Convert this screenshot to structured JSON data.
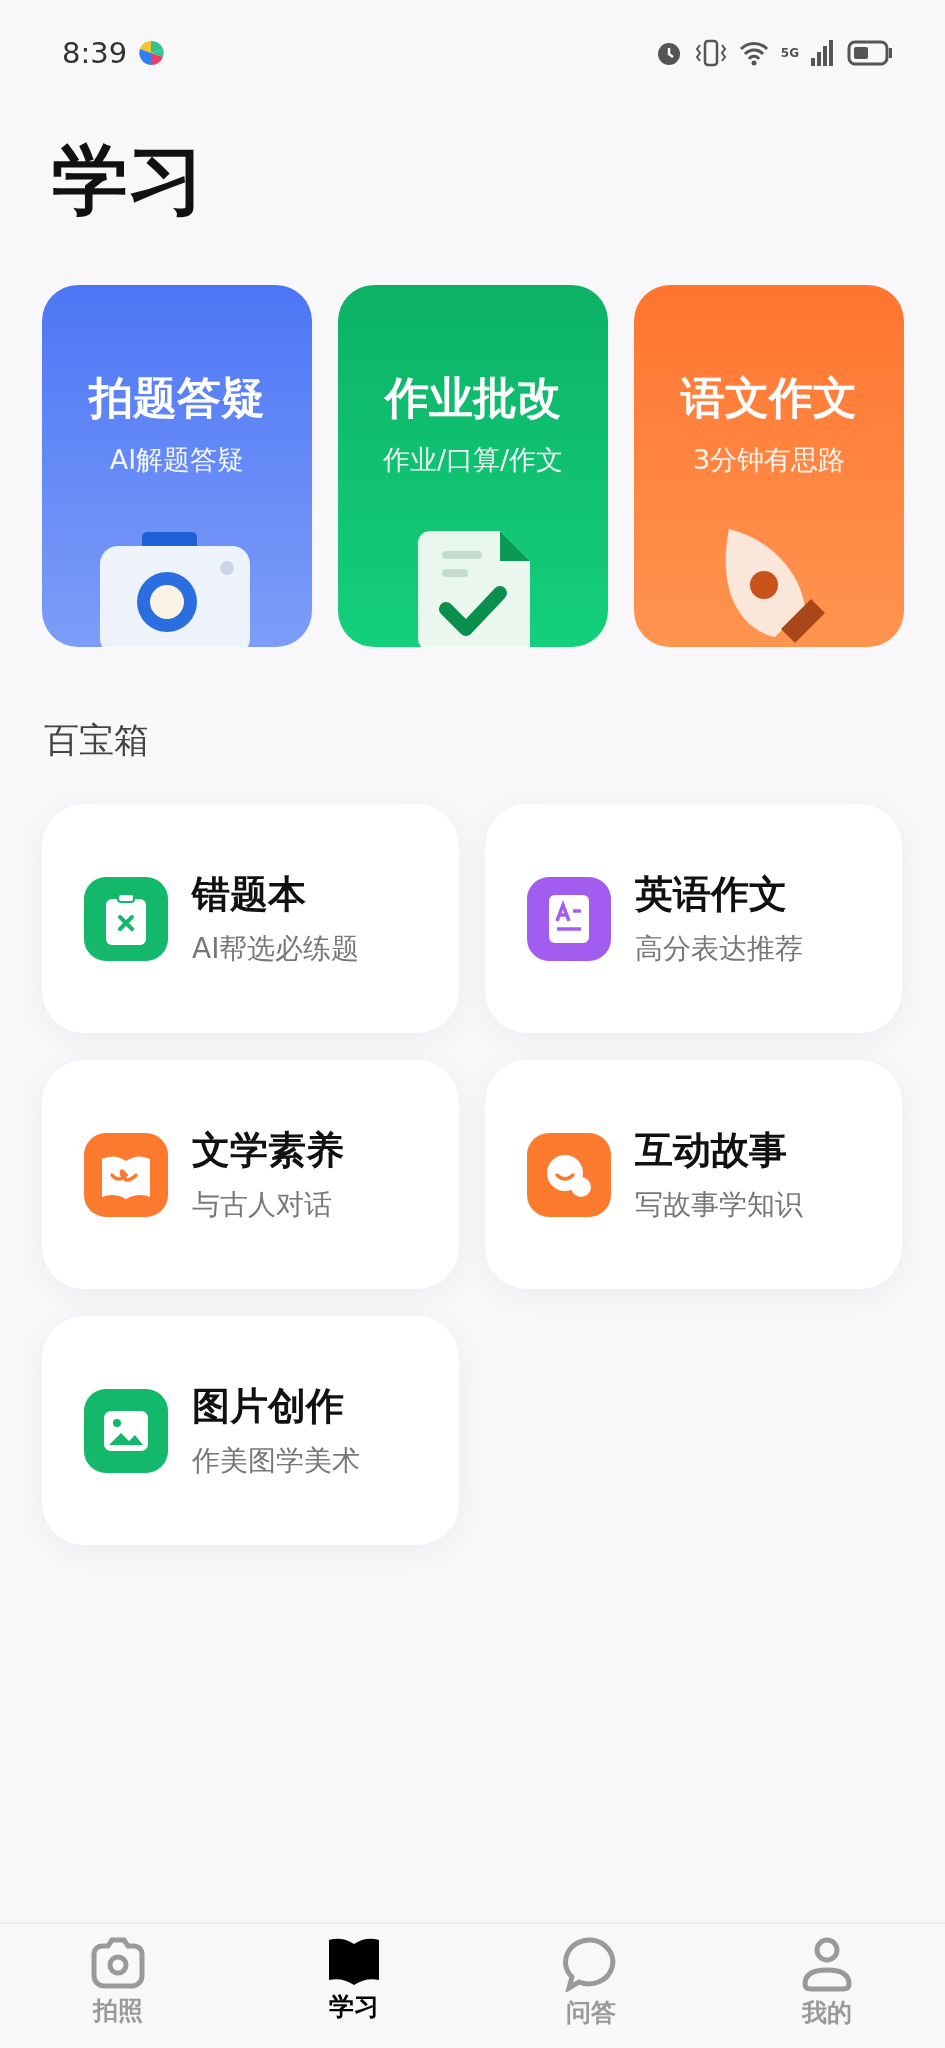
{
  "status_bar": {
    "time": "8:39",
    "network": "5G"
  },
  "title": "学习",
  "features": [
    {
      "kind": "camera",
      "title": "拍题答疑",
      "subtitle": "AI解题答疑"
    },
    {
      "kind": "document",
      "title": "作业批改",
      "subtitle": "作业/口算/作文"
    },
    {
      "kind": "pen",
      "title": "语文作文",
      "subtitle": "3分钟有思路"
    }
  ],
  "toolbox": {
    "heading": "百宝箱",
    "items": [
      {
        "kind": "clipboard",
        "color": "#14b86a",
        "title": "错题本",
        "subtitle": "AI帮选必练题"
      },
      {
        "kind": "letter",
        "color": "#a35cf0",
        "title": "英语作文",
        "subtitle": "高分表达推荐"
      },
      {
        "kind": "book",
        "color": "#fb7a2e",
        "title": "文学素养",
        "subtitle": "与古人对话"
      },
      {
        "kind": "chat",
        "color": "#fb7a2e",
        "title": "互动故事",
        "subtitle": "写故事学知识"
      },
      {
        "kind": "image",
        "color": "#14b86a",
        "title": "图片创作",
        "subtitle": "作美图学美术"
      }
    ]
  },
  "nav": [
    {
      "kind": "camera",
      "label": "拍照",
      "selected": false
    },
    {
      "kind": "book",
      "label": "学习",
      "selected": true
    },
    {
      "kind": "chat",
      "label": "问答",
      "selected": false
    },
    {
      "kind": "person",
      "label": "我的",
      "selected": false
    }
  ]
}
